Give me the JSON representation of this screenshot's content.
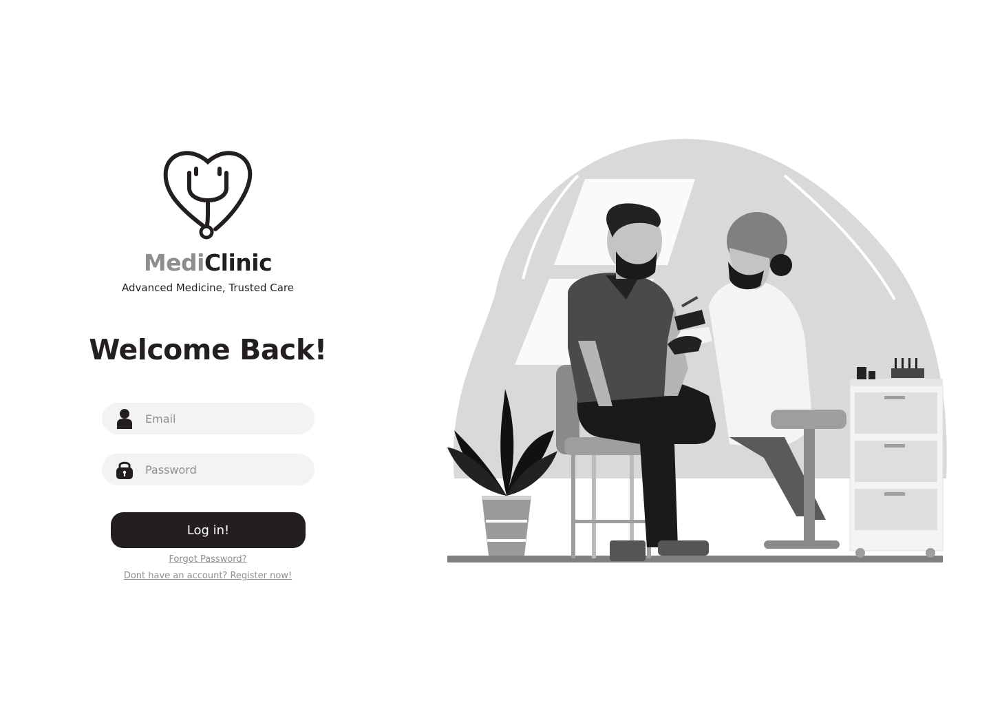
{
  "brand": {
    "name_part1": "Medi",
    "name_part2": "Clinic",
    "tagline": "Advanced Medicine, Trusted Care"
  },
  "heading": "Welcome Back!",
  "form": {
    "email": {
      "placeholder": "Email",
      "value": ""
    },
    "password": {
      "placeholder": "Password",
      "value": ""
    },
    "submit_label": "Log in!"
  },
  "links": {
    "forgot": "Forgot Password?",
    "register": "Dont have an account? Register now!"
  },
  "colors": {
    "primary": "#231f20",
    "secondary_text": "#8e8e8e",
    "input_bg": "#f3f3f3",
    "illustration_blob": "#d9d9d9"
  },
  "icons": {
    "logo": "heart-stethoscope-icon",
    "email_field": "user-icon",
    "password_field": "lock-icon"
  }
}
